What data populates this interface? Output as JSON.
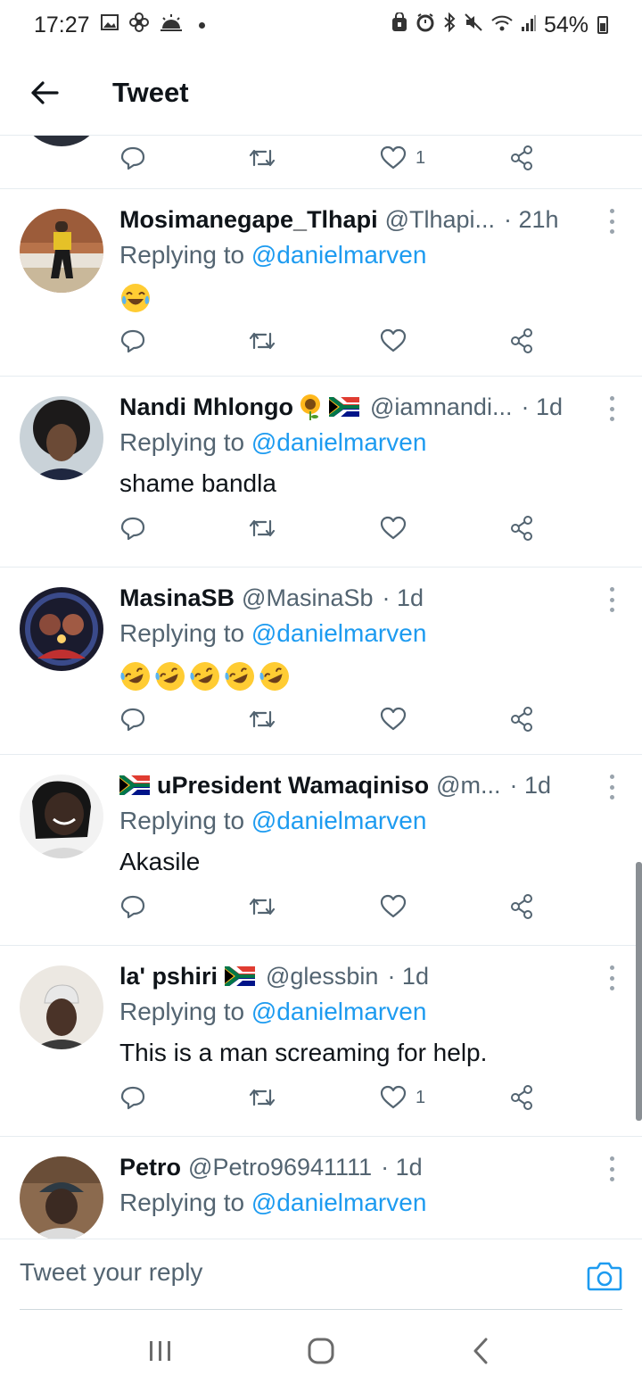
{
  "status_bar": {
    "time": "17:27",
    "battery": "54%",
    "icons_left": [
      "image-icon",
      "fan-icon",
      "weather-icon",
      "dot-icon"
    ],
    "icons_right": [
      "alarm-icon",
      "clock-icon",
      "bluetooth-icon",
      "mute-icon",
      "wifi-icon",
      "signal-icon",
      "battery-icon"
    ]
  },
  "header": {
    "title": "Tweet"
  },
  "partial_tweet": {
    "like_count": "1"
  },
  "tweets": [
    {
      "name": "Mosimanegape_Tlhapi",
      "handle": "@Tlhapi...",
      "time": "· 21h",
      "replying_label": "Replying to",
      "mention": "@danielmarven",
      "text": "😂",
      "like_count": ""
    },
    {
      "name": "Nandi Mhlongo",
      "handle": "@iamnandi...",
      "time": "· 1d",
      "replying_label": "Replying to",
      "mention": "@danielmarven",
      "text": "shame bandla",
      "like_count": ""
    },
    {
      "name": "MasinaSB",
      "handle": "@MasinaSb",
      "time": "· 1d",
      "replying_label": "Replying to",
      "mention": "@danielmarven",
      "text": "🤣🤣🤣🤣🤣",
      "like_count": ""
    },
    {
      "name": "uPresident Wamaqiniso",
      "handle": "@m...",
      "time": "· 1d",
      "replying_label": "Replying to",
      "mention": "@danielmarven",
      "text": "Akasile",
      "like_count": ""
    },
    {
      "name": "la' pshiri",
      "handle": "@glessbin",
      "time": "· 1d",
      "replying_label": "Replying to",
      "mention": "@danielmarven",
      "text": "This is a man screaming for help.",
      "like_count": "1"
    },
    {
      "name": "Petro",
      "handle": "@Petro96941111",
      "time": "· 1d",
      "replying_label": "Replying to",
      "mention": "@danielmarven",
      "text": "",
      "like_count": ""
    }
  ],
  "reply_bar": {
    "placeholder": "Tweet your reply"
  },
  "colors": {
    "accent": "#1d9bf0",
    "secondary_text": "#536471",
    "divider": "#e6ecf0"
  }
}
